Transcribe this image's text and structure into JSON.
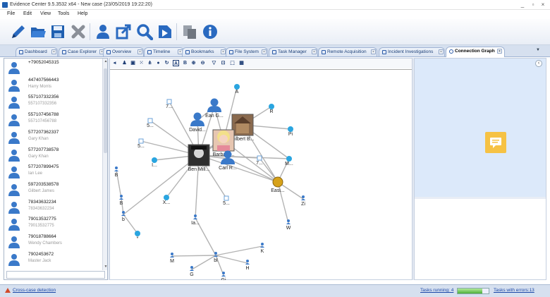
{
  "window": {
    "title": "Evidence Center 9.5.3532 x64 - New case (23/05/2019 19:22:20)"
  },
  "menu": [
    "File",
    "Edit",
    "View",
    "Tools",
    "Help"
  ],
  "toolbar": {
    "icons": [
      "pencil-icon",
      "open-folder-icon",
      "save-icon",
      "close-x-icon",
      "users-icon",
      "export-icon",
      "search-icon",
      "forward-icon",
      "copy-icon",
      "info-icon"
    ]
  },
  "tabs": [
    {
      "label": "Dashboard",
      "icon": "dashboard-icon"
    },
    {
      "label": "Case Explorer",
      "icon": "case-explorer-icon"
    },
    {
      "label": "Overview",
      "icon": "overview-icon"
    },
    {
      "label": "Timeline",
      "icon": "timeline-icon"
    },
    {
      "label": "Bookmarks",
      "icon": "bookmark-icon"
    },
    {
      "label": "File System",
      "icon": "file-system-icon"
    },
    {
      "label": "Task Manager",
      "icon": "task-manager-icon"
    },
    {
      "label": "Remote Acquisition",
      "icon": "remote-acquisition-icon"
    },
    {
      "label": "Incident Investigations",
      "icon": "incident-icon"
    },
    {
      "label": "Connection Graph",
      "icon": "connection-graph-icon",
      "active": true
    }
  ],
  "contacts": [
    {
      "number": "+79052045315",
      "name": ""
    },
    {
      "number": "447407566443",
      "name": "Harry Morris"
    },
    {
      "number": "557107332356",
      "name": "557107332356"
    },
    {
      "number": "557107456788",
      "name": "557107456788"
    },
    {
      "number": "577207362337",
      "name": "Gary Khan"
    },
    {
      "number": "577207738578",
      "name": "Gary Khan"
    },
    {
      "number": "577207899475",
      "name": "Ian Lee"
    },
    {
      "number": "597203538578",
      "name": "Gilbert James"
    },
    {
      "number": "78343632234",
      "name": "78343632234"
    },
    {
      "number": "79013532775",
      "name": "79013532775"
    },
    {
      "number": "79018788664",
      "name": "Wendy Chambers"
    },
    {
      "number": "7902453672",
      "name": "Master Jack"
    }
  ],
  "graph": {
    "toolbar_labels": [
      "A",
      "B"
    ],
    "nodes": [
      {
        "label": "A",
        "kind": "skype"
      },
      {
        "label": "7...",
        "kind": "doc"
      },
      {
        "label": "Ean G...",
        "kind": "person"
      },
      {
        "label": "R",
        "kind": "skype"
      },
      {
        "label": "5...",
        "kind": "doc"
      },
      {
        "label": "David...",
        "kind": "person"
      },
      {
        "label": "Gilbert B...",
        "kind": "photo-house"
      },
      {
        "label": "Pi",
        "kind": "skype"
      },
      {
        "label": "5...",
        "kind": "doc"
      },
      {
        "label": "Barbara...",
        "kind": "photo-woman"
      },
      {
        "label": "Ben Mill...",
        "kind": "photo-man"
      },
      {
        "label": "I...",
        "kind": "skype"
      },
      {
        "label": "Carl R...",
        "kind": "person"
      },
      {
        "label": "7...",
        "kind": "doc"
      },
      {
        "label": "M...",
        "kind": "skype"
      },
      {
        "label": "B",
        "kind": "small"
      },
      {
        "label": "Easi...",
        "kind": "coin"
      },
      {
        "label": "B",
        "kind": "small"
      },
      {
        "label": "b",
        "kind": "small"
      },
      {
        "label": "X...",
        "kind": "skype"
      },
      {
        "label": "5...",
        "kind": "doc"
      },
      {
        "label": "Zi",
        "kind": "small"
      },
      {
        "label": "W",
        "kind": "small"
      },
      {
        "label": "Ia...",
        "kind": "small"
      },
      {
        "label": "*",
        "kind": "skype"
      },
      {
        "label": "K",
        "kind": "small"
      },
      {
        "label": "bl",
        "kind": "small"
      },
      {
        "label": "M",
        "kind": "small"
      },
      {
        "label": "H",
        "kind": "small"
      },
      {
        "label": "G",
        "kind": "small"
      },
      {
        "label": "Gi",
        "kind": "small"
      }
    ]
  },
  "status": {
    "cross_case": "Cross-case detection",
    "tasks_running": "Tasks running: 4",
    "tasks_errors": "Tasks with errors:13",
    "progress": 0.8
  },
  "colors": {
    "accent": "#1f5fb0",
    "panel": "#dce9fa",
    "note": "#f6c244"
  }
}
